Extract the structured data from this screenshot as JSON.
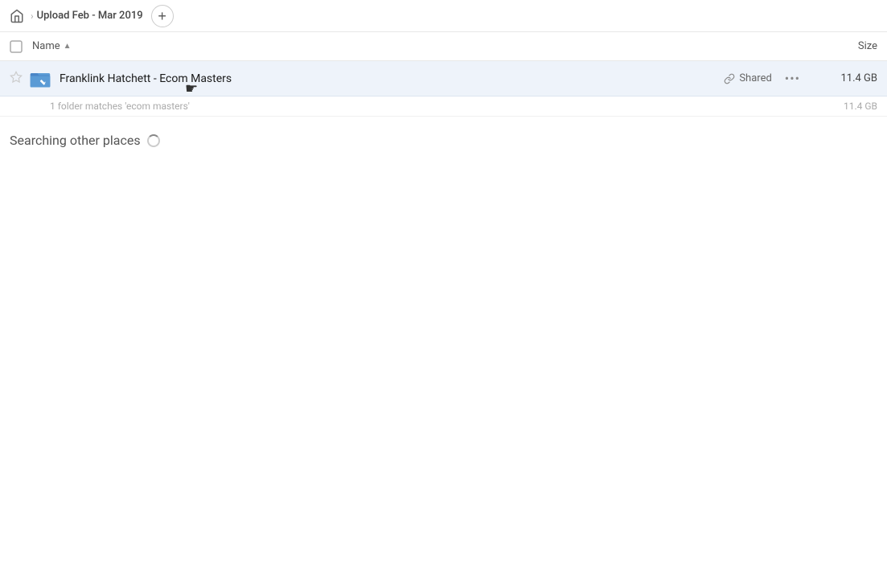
{
  "header": {
    "home_icon": "🏠",
    "breadcrumb_title": "Upload Feb - Mar 2019",
    "add_button_label": "+"
  },
  "table": {
    "col_name_label": "Name",
    "col_size_label": "Size"
  },
  "file_row": {
    "star_icon": "☆",
    "folder_name": "Franklink Hatchett - Ecom Masters",
    "shared_label": "Shared",
    "more_icon": "•••",
    "file_size": "11.4 GB"
  },
  "match_row": {
    "text": "1 folder matches 'ecom masters'",
    "size": "11.4 GB"
  },
  "searching": {
    "text": "Searching other places"
  }
}
